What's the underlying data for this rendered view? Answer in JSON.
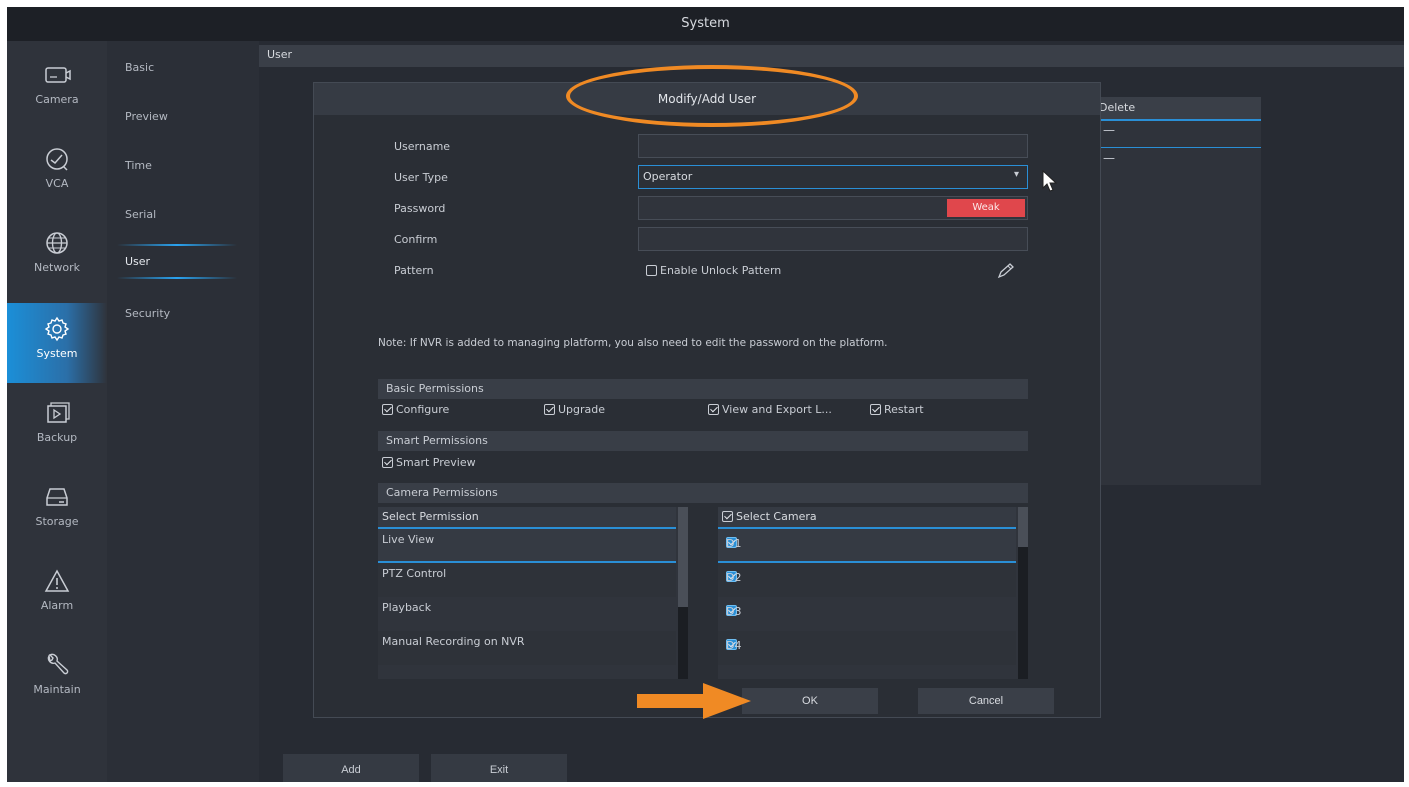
{
  "window": {
    "title": "System"
  },
  "nav": {
    "items": [
      {
        "label": "Camera",
        "icon": "camera-icon"
      },
      {
        "label": "VCA",
        "icon": "vca-icon"
      },
      {
        "label": "Network",
        "icon": "globe-icon"
      },
      {
        "label": "System",
        "icon": "gear-icon",
        "active": true
      },
      {
        "label": "Backup",
        "icon": "backup-icon"
      },
      {
        "label": "Storage",
        "icon": "hdd-icon"
      },
      {
        "label": "Alarm",
        "icon": "warning-icon"
      },
      {
        "label": "Maintain",
        "icon": "wrench-icon"
      }
    ]
  },
  "subnav": {
    "items": [
      "Basic",
      "Preview",
      "Time",
      "Serial",
      "User",
      "Security"
    ],
    "active": "User"
  },
  "content": {
    "section_title": "User",
    "table": {
      "delete_header": "Delete",
      "rows": [
        "—",
        "—"
      ]
    },
    "add_label": "Add",
    "exit_label": "Exit"
  },
  "dialog": {
    "title": "Modify/Add User",
    "username_label": "Username",
    "username_value": "",
    "user_type_label": "User Type",
    "user_type_value": "Operator",
    "password_label": "Password",
    "password_strength": "Weak",
    "confirm_label": "Confirm",
    "pattern_label": "Pattern",
    "enable_pattern_label": "Enable Unlock Pattern",
    "note": "Note: If NVR is added to managing platform, you also need to edit the password on the platform.",
    "basic_permissions": {
      "title": "Basic Permissions",
      "items": [
        {
          "label": "Configure",
          "checked": true
        },
        {
          "label": "Upgrade",
          "checked": true
        },
        {
          "label": "View and Export L...",
          "checked": true
        },
        {
          "label": "Restart",
          "checked": true
        }
      ]
    },
    "smart_permissions": {
      "title": "Smart Permissions",
      "items": [
        {
          "label": "Smart Preview",
          "checked": true
        }
      ]
    },
    "camera_permissions": {
      "title": "Camera Permissions",
      "select_permission_header": "Select Permission",
      "permissions": [
        "Live View",
        "PTZ Control",
        "Playback",
        "Manual Recording on NVR"
      ],
      "select_camera_header": "Select Camera",
      "cameras": [
        "D1",
        "D2",
        "D3",
        "D4"
      ]
    },
    "ok_label": "OK",
    "cancel_label": "Cancel"
  },
  "colors": {
    "accent_blue": "#2a8fd6",
    "annotation_orange": "#f08a24",
    "weak_red": "#e0474c"
  }
}
